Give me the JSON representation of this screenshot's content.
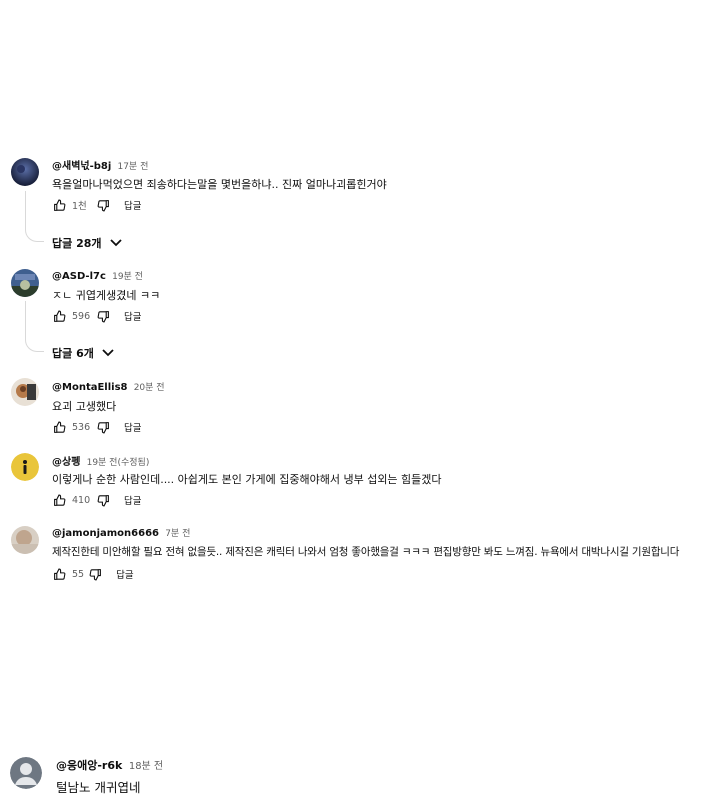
{
  "comments": [
    {
      "author": "@새벽넋-b8j",
      "time": "17분 전",
      "text": "욕을얼마나먹었으면 죄송하다는말을 몇번을하냐.. 진짜 얼마나괴롭힌거야",
      "likes": "1천",
      "reply_label": "답글",
      "replies_label": "답글 28개"
    },
    {
      "author": "@ASD-l7c",
      "time": "19분 전",
      "text": "ㅈㄴ 귀엽게생겼네 ㅋㅋ",
      "likes": "596",
      "reply_label": "답글",
      "replies_label": "답글 6개"
    },
    {
      "author": "@MontaEllis8",
      "time": "20분 전",
      "text": "요괴 고생했다",
      "likes": "536",
      "reply_label": "답글"
    },
    {
      "author": "@상펭",
      "time": "19분 전(수정됨)",
      "text": "이렇게나 순한 사람인데.... 아쉽게도 본인 가게에 집중해야해서 냉부 섭외는 힘들겠다",
      "likes": "410",
      "reply_label": "답글"
    },
    {
      "author": "@jamonjamon6666",
      "time": "7분 전",
      "text": "제작진한테 미안해할 필요 전혀 없을듯.. 제작진은 캐릭터 나와서 엄청 좋아했을걸 ㅋㅋㅋ 편집방향만 봐도 느껴짐. 뉴욕에서 대박나시길 기원합니다",
      "likes": "55",
      "reply_label": "답글"
    },
    {
      "author": "@응애앙-r6k",
      "time": "18분 전",
      "text": "털남노 개귀엽네"
    }
  ]
}
